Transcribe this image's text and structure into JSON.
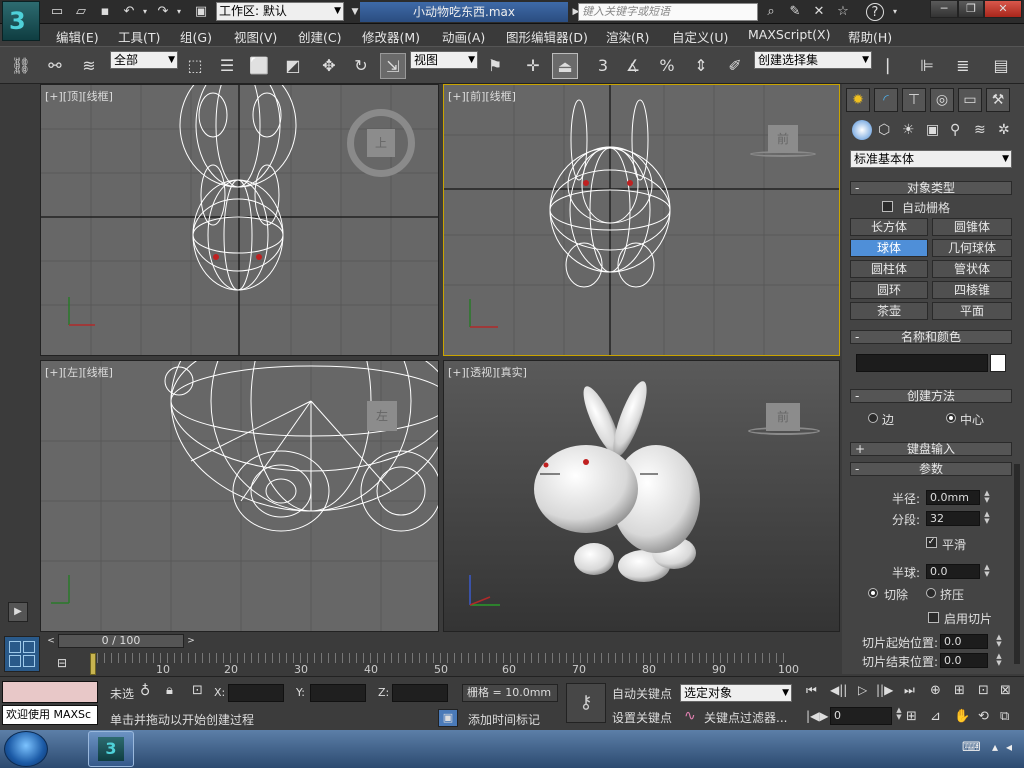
{
  "titlebar": {
    "workspace_label": "工作区: 默认",
    "document_title": "小动物吃东西.max",
    "search_placeholder": "键入关键字或短语"
  },
  "menu": [
    "编辑(E)",
    "工具(T)",
    "组(G)",
    "视图(V)",
    "创建(C)",
    "修改器(M)",
    "动画(A)",
    "图形编辑器(D)",
    "渲染(R)",
    "自定义(U)",
    "MAXScript(X)",
    "帮助(H)"
  ],
  "toolbar": {
    "selection_filter": "全部",
    "ref_coord": "视图",
    "named_selection": "创建选择集",
    "snap_3": "3"
  },
  "viewports": {
    "top": {
      "label": "[+][顶][线框]",
      "cube": "上"
    },
    "front": {
      "label": "[+][前][线框]",
      "cube": "前"
    },
    "left": {
      "label": "[+][左][线框]",
      "cube": "左"
    },
    "persp": {
      "label": "[+][透视][真实]",
      "cube": "前"
    }
  },
  "command_panel": {
    "category": "标准基本体",
    "object_type": {
      "title": "对象类型",
      "autogrid": "自动栅格",
      "buttons": [
        "长方体",
        "圆锥体",
        "球体",
        "几何球体",
        "圆柱体",
        "管状体",
        "圆环",
        "四棱锥",
        "茶壶",
        "平面"
      ],
      "active": "球体"
    },
    "name_color": {
      "title": "名称和颜色",
      "name_value": ""
    },
    "creation_method": {
      "title": "创建方法",
      "edge": "边",
      "center": "中心"
    },
    "keyboard_entry": {
      "title": "键盘输入"
    },
    "parameters": {
      "title": "参数",
      "radius_label": "半径:",
      "radius_value": "0.0mm",
      "segments_label": "分段:",
      "segments_value": "32",
      "smooth_label": "平滑",
      "hemisphere_label": "半球:",
      "hemisphere_value": "0.0",
      "chop_label": "切除",
      "squash_label": "挤压",
      "slice_on_label": "启用切片",
      "slice_from_label": "切片起始位置:",
      "slice_from_value": "0.0",
      "slice_to_label": "切片结束位置:",
      "slice_to_value": "0.0"
    }
  },
  "timeline": {
    "frame_counter": "0 / 100",
    "ticks": [
      "10",
      "20",
      "30",
      "40",
      "50",
      "60",
      "70",
      "80",
      "90",
      "100"
    ]
  },
  "status": {
    "maxscript_line": "欢迎使用 MAXSc",
    "selection_state": "未选",
    "x_label": "X:",
    "y_label": "Y:",
    "z_label": "Z:",
    "grid": "栅格 = 10.0mm",
    "auto_key": "自动关键点",
    "set_key": "设置关键点",
    "key_mode": "选定对象",
    "key_filters": "关键点过滤器...",
    "prompt": "单击并拖动以开始创建过程",
    "add_time_tag": "添加时间标记",
    "current_frame": "0"
  },
  "colors": {
    "active_button": "#4f8fd8",
    "active_viewport_border": "#c9a400",
    "wire": "#ffffff",
    "eye": "#c02020"
  }
}
